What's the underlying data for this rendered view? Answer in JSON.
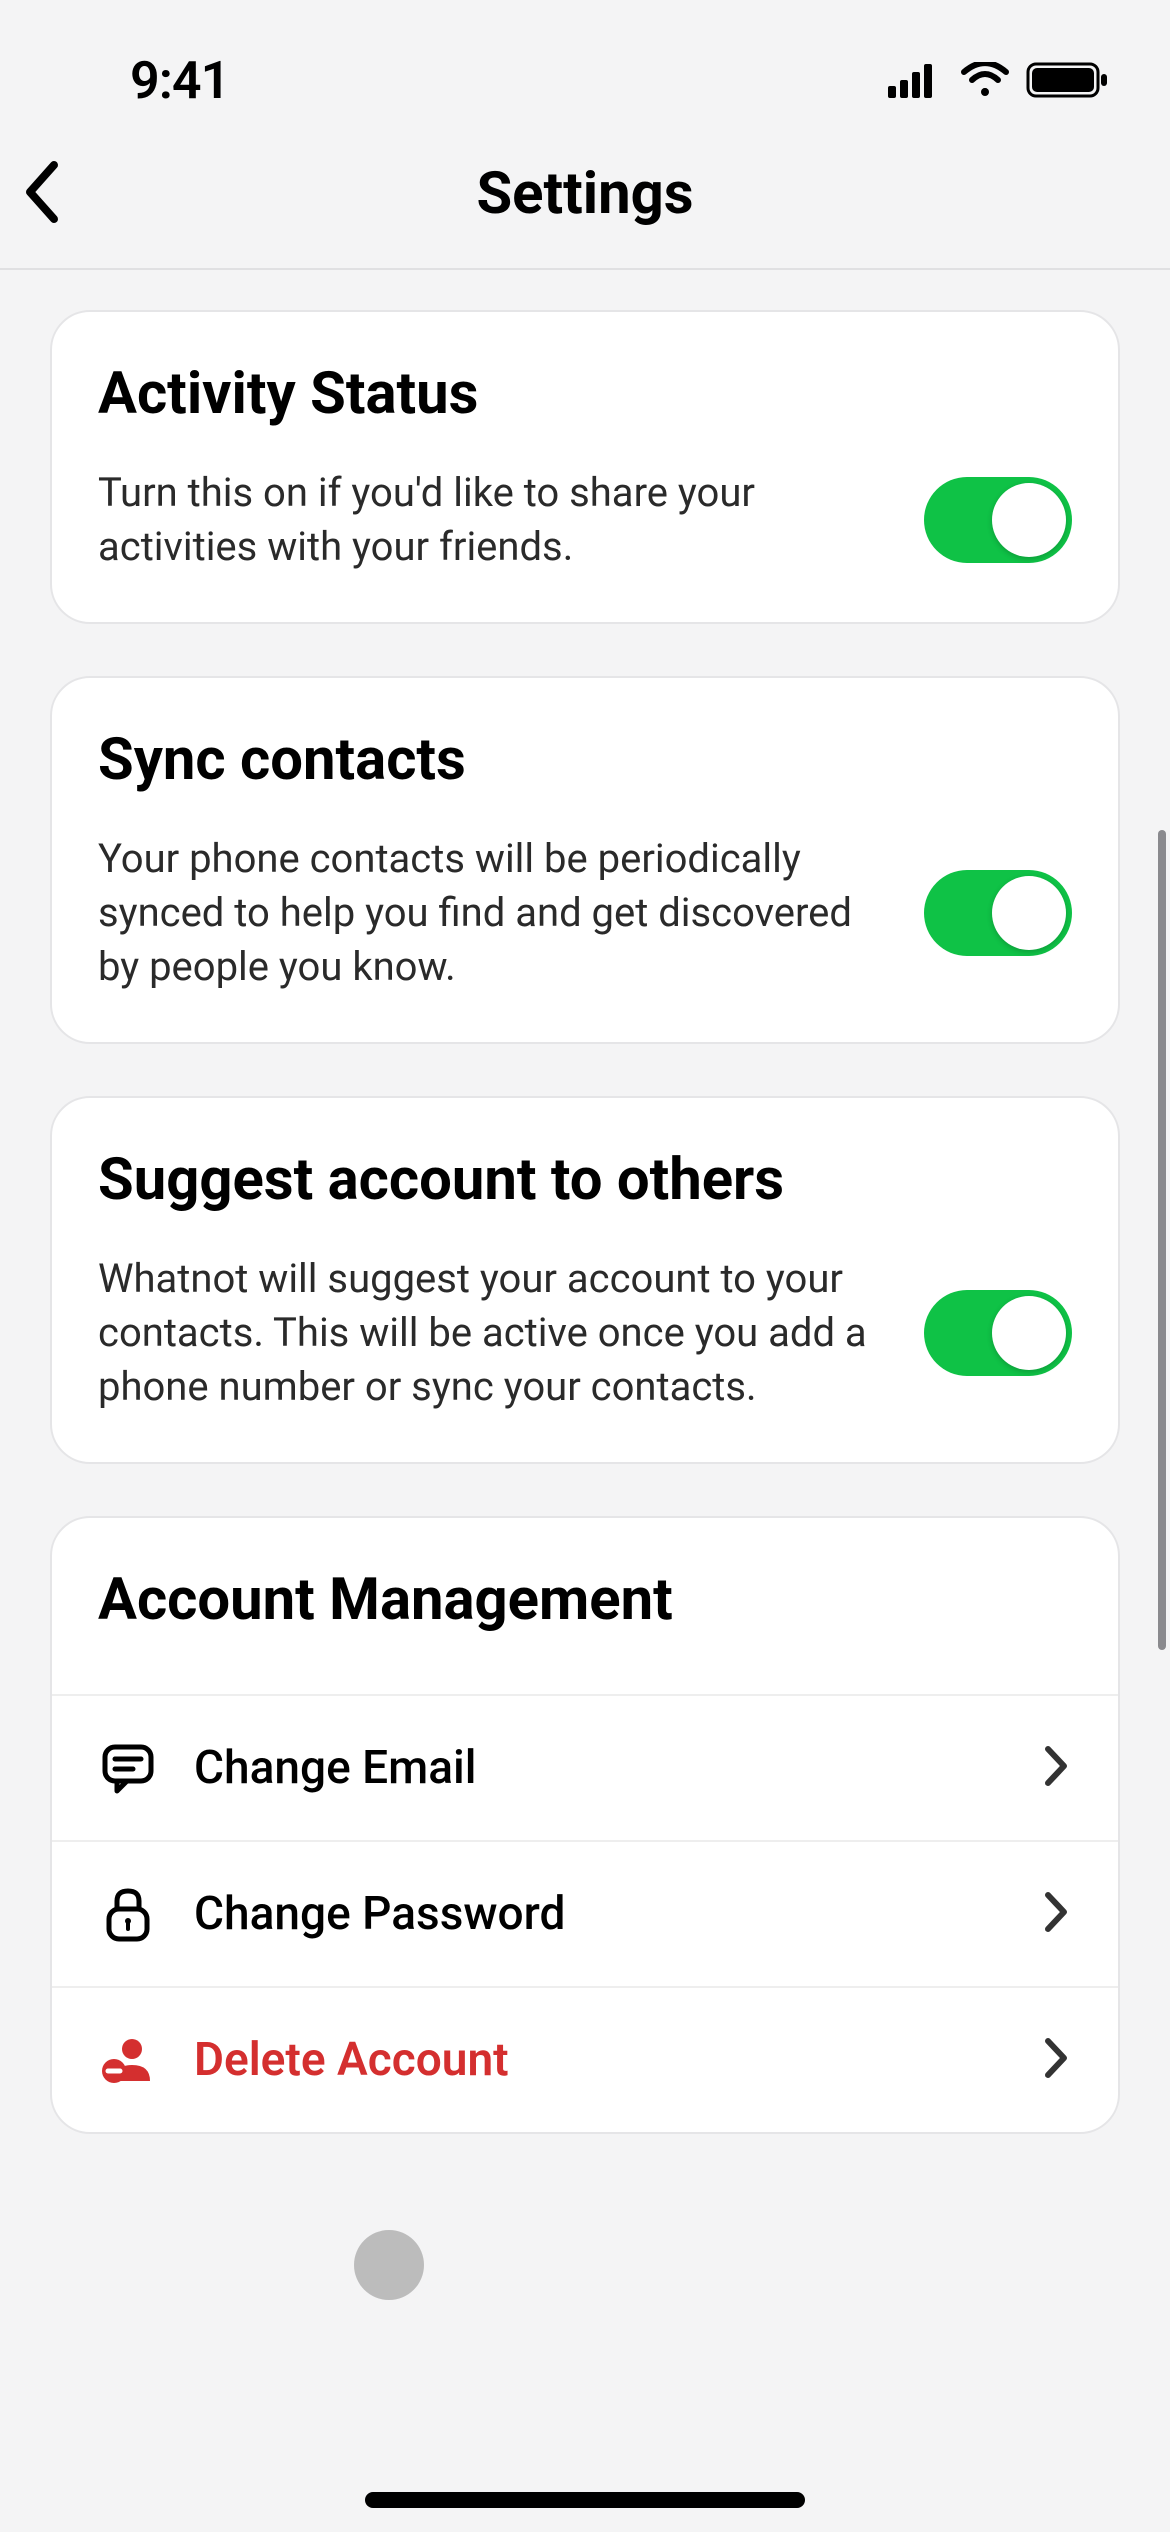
{
  "status": {
    "time": "9:41"
  },
  "nav": {
    "title": "Settings"
  },
  "cards": {
    "activity": {
      "title": "Activity Status",
      "desc": "Turn this on if you'd like to share your activities with your friends.",
      "toggled": true
    },
    "sync": {
      "title": "Sync contacts",
      "desc": "Your phone contacts will be periodically synced to help you find and get discovered by people you know.",
      "toggled": true
    },
    "suggest": {
      "title": "Suggest account to others",
      "desc": "Whatnot will suggest your account to your contacts. This will be active once you add a phone number or sync your contacts.",
      "toggled": true
    },
    "account": {
      "title": "Account Management",
      "rows": {
        "email": "Change Email",
        "password": "Change Password",
        "delete": "Delete Account"
      }
    }
  }
}
